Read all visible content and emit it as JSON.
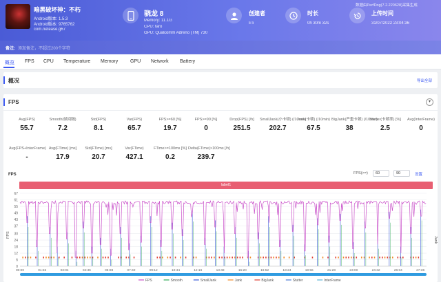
{
  "header": {
    "game_name": "暗黑破坏神：不朽",
    "android_version": "Android版本: 1.5.3",
    "android_code": "Android版本: 9765762",
    "package": "com.netease.g67",
    "device": {
      "name": "骁龙 8",
      "memory": "Memory: 11.1G",
      "cpu": "CPU: taro",
      "gpu": "GPU: Qualcomm Adreno (TM) 730"
    },
    "creator": {
      "title": "创建者",
      "value": "li li"
    },
    "duration": {
      "title": "时长",
      "value": "0h 30m 32s"
    },
    "upload": {
      "title": "上传时间",
      "value": "31/07/2022 23:04:36"
    },
    "data_source": "数据由PerfDog(7.2.220628)采集生成"
  },
  "note": {
    "label": "备注:",
    "placeholder": "添加备注，不超过200个字符"
  },
  "tabs": [
    "概览",
    "FPS",
    "CPU",
    "Temperature",
    "Memory",
    "GPU",
    "Network",
    "Battery"
  ],
  "overview": {
    "title": "概况",
    "export": "导出全部"
  },
  "fps_panel": {
    "title": "FPS",
    "row1": [
      {
        "label": "Avg(FPS)",
        "value": "55.7"
      },
      {
        "label": "Smooth(帧间隔)",
        "value": "7.2"
      },
      {
        "label": "Std(FPS)",
        "value": "8.1"
      },
      {
        "label": "Var(FPS)",
        "value": "65.7"
      },
      {
        "label": "FPS>=60 [%]",
        "value": "19.7"
      },
      {
        "label": "FPS>=90 [%]",
        "value": "0"
      },
      {
        "label": "Drop(FPS) [/h]",
        "value": "251.5"
      },
      {
        "label": "SmallJank(小卡顿) (/10min)",
        "value": "202.7"
      },
      {
        "label": "Jank(卡顿) (/10min)",
        "value": "67.5"
      },
      {
        "label": "BigJank(严重卡顿) (/10min)",
        "value": "38"
      },
      {
        "label": "Stutter(卡顿率) [%]",
        "value": "2.5"
      },
      {
        "label": "Avg(InterFrame)",
        "value": "0"
      }
    ],
    "row2": [
      {
        "label": "Avg(FPS+InterFrame)",
        "value": "-"
      },
      {
        "label": "Avg(FTime) [ms]",
        "value": "17.9"
      },
      {
        "label": "Std(FTime) [ms]",
        "value": "20.7"
      },
      {
        "label": "Var(FTime)",
        "value": "427.1"
      },
      {
        "label": "FTime>=100ms [%]",
        "value": "0.2"
      },
      {
        "label": "Delta(FTime)>100ms [/h]",
        "value": "239.7"
      }
    ],
    "chart_title": "FPS",
    "threshold_label": "FPS(>=)",
    "threshold_min": "60",
    "threshold_max": "90",
    "threshold_set": "设置",
    "label_bar": "label1"
  },
  "chart_data": {
    "type": "line",
    "y_ticks": [
      "67",
      "61",
      "55",
      "49",
      "43",
      "37",
      "30",
      "24",
      "18",
      "12",
      "6",
      "0"
    ],
    "ylabel": "FPS",
    "y2label": "Jank",
    "x_ticks": [
      "00:00",
      "01:32",
      "03:04",
      "04:36",
      "06:08",
      "07:40",
      "09:12",
      "10:44",
      "12:16",
      "13:48",
      "15:20",
      "16:52",
      "18:24",
      "19:56",
      "21:28",
      "23:00",
      "24:32",
      "26:04",
      "27:36"
    ],
    "ylim": [
      0,
      67
    ],
    "series_colors": {
      "FPS": "#c94fc9",
      "Smooth": "#2eaa55",
      "SmallJank": "#3a5bd9",
      "Jank": "#f08a24",
      "BigJank": "#e03c31",
      "Stutter": "#4c7bd6",
      "InterFrame": "#5ab4d6"
    },
    "legend": [
      "FPS",
      "Smooth",
      "SmallJank",
      "Jank",
      "BigJank",
      "Stutter",
      "InterFrame"
    ],
    "fps_baseline": 60,
    "drop_events": [
      {
        "t": 0.5,
        "fps": 40
      },
      {
        "t": 1.2,
        "fps": 18
      },
      {
        "t": 2.1,
        "fps": 30
      },
      {
        "t": 2.6,
        "fps": 12
      },
      {
        "t": 3.3,
        "fps": 25
      },
      {
        "t": 3.9,
        "fps": 8
      },
      {
        "t": 4.4,
        "fps": 35
      },
      {
        "t": 5.0,
        "fps": 12
      },
      {
        "t": 5.6,
        "fps": 20
      },
      {
        "t": 6.3,
        "fps": 10
      },
      {
        "t": 7.0,
        "fps": 30
      },
      {
        "t": 7.6,
        "fps": 15
      },
      {
        "t": 8.4,
        "fps": 22
      },
      {
        "t": 9.1,
        "fps": 40
      },
      {
        "t": 9.8,
        "fps": 18
      },
      {
        "t": 10.6,
        "fps": 34
      },
      {
        "t": 11.3,
        "fps": 28
      },
      {
        "t": 12.0,
        "fps": 45
      },
      {
        "t": 12.9,
        "fps": 20
      },
      {
        "t": 13.6,
        "fps": 36
      },
      {
        "t": 14.2,
        "fps": 12
      },
      {
        "t": 15.0,
        "fps": 30
      },
      {
        "t": 15.9,
        "fps": 8
      },
      {
        "t": 16.6,
        "fps": 25
      },
      {
        "t": 17.3,
        "fps": 40
      },
      {
        "t": 18.1,
        "fps": 18
      },
      {
        "t": 19.0,
        "fps": 32
      },
      {
        "t": 19.8,
        "fps": 14
      },
      {
        "t": 20.7,
        "fps": 38
      },
      {
        "t": 21.5,
        "fps": 22
      },
      {
        "t": 22.3,
        "fps": 42
      },
      {
        "t": 23.2,
        "fps": 16
      },
      {
        "t": 24.0,
        "fps": 35
      },
      {
        "t": 24.9,
        "fps": 20
      },
      {
        "t": 25.7,
        "fps": 44
      },
      {
        "t": 26.5,
        "fps": 12
      },
      {
        "t": 27.2,
        "fps": 30
      },
      {
        "t": 27.9,
        "fps": 46
      }
    ]
  }
}
